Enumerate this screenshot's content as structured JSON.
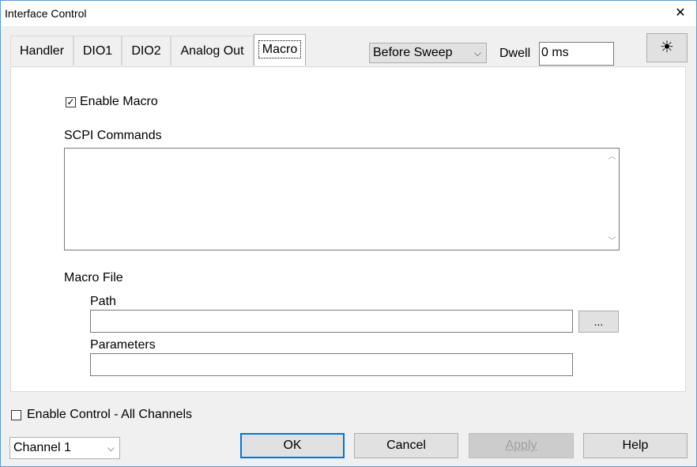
{
  "window": {
    "title": "Interface Control",
    "close_glyph": "✕"
  },
  "tabs": [
    {
      "label": "Handler",
      "active": false
    },
    {
      "label": "DIO1",
      "active": false
    },
    {
      "label": "DIO2",
      "active": false
    },
    {
      "label": "Analog Out",
      "active": false
    },
    {
      "label": "Macro",
      "active": true
    }
  ],
  "toolbar": {
    "timing_select": "Before Sweep",
    "dwell_label": "Dwell",
    "dwell_value": "0 ms",
    "brightness_icon": "☀"
  },
  "macro": {
    "enable_label": "Enable Macro",
    "enable_checked": true,
    "scpi_label": "SCPI Commands",
    "scpi_value": "",
    "file_label": "Macro File",
    "path_label": "Path",
    "path_value": "",
    "browse_label": "...",
    "params_label": "Parameters",
    "params_value": ""
  },
  "footer": {
    "enable_all_label": "Enable Control - All Channels",
    "enable_all_checked": false,
    "channel_select": "Channel 1",
    "ok_label": "OK",
    "cancel_label": "Cancel",
    "apply_label": "Apply",
    "help_label": "Help"
  },
  "glyphs": {
    "check": "✓",
    "chevron_down": "⌵",
    "scroll_up": "︿",
    "scroll_down": "﹀"
  }
}
